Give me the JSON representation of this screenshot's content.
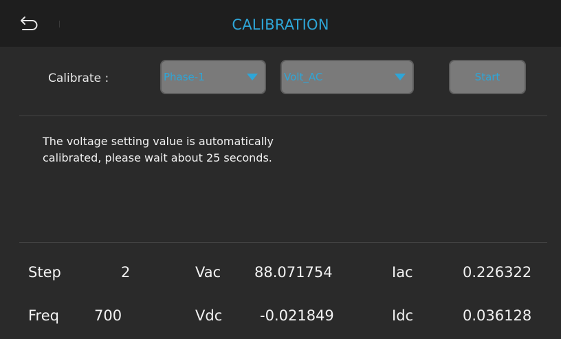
{
  "header": {
    "title": "CALIBRATION",
    "back_icon": "back-arrow-icon"
  },
  "controls": {
    "calibrate_label": "Calibrate :",
    "phase_dropdown": {
      "selected": "Phase-1"
    },
    "mode_dropdown": {
      "selected": "Volt_AC"
    },
    "start_label": "Start"
  },
  "message": "The voltage setting value is automatically\ncalibrated, please wait about 25 seconds.",
  "readings": {
    "step_label": "Step",
    "step_value": "2",
    "vac_label": "Vac",
    "vac_value": "88.071754",
    "iac_label": "Iac",
    "iac_value": "0.226322",
    "freq_label": "Freq",
    "freq_value": "700",
    "vdc_label": "Vdc",
    "vdc_value": "-0.021849",
    "idc_label": "Idc",
    "idc_value": "0.036128"
  },
  "colors": {
    "accent": "#2ea6d8",
    "background": "#2a2a2a",
    "header_background": "#1e1e1e",
    "control_background": "#7a7a7a"
  }
}
